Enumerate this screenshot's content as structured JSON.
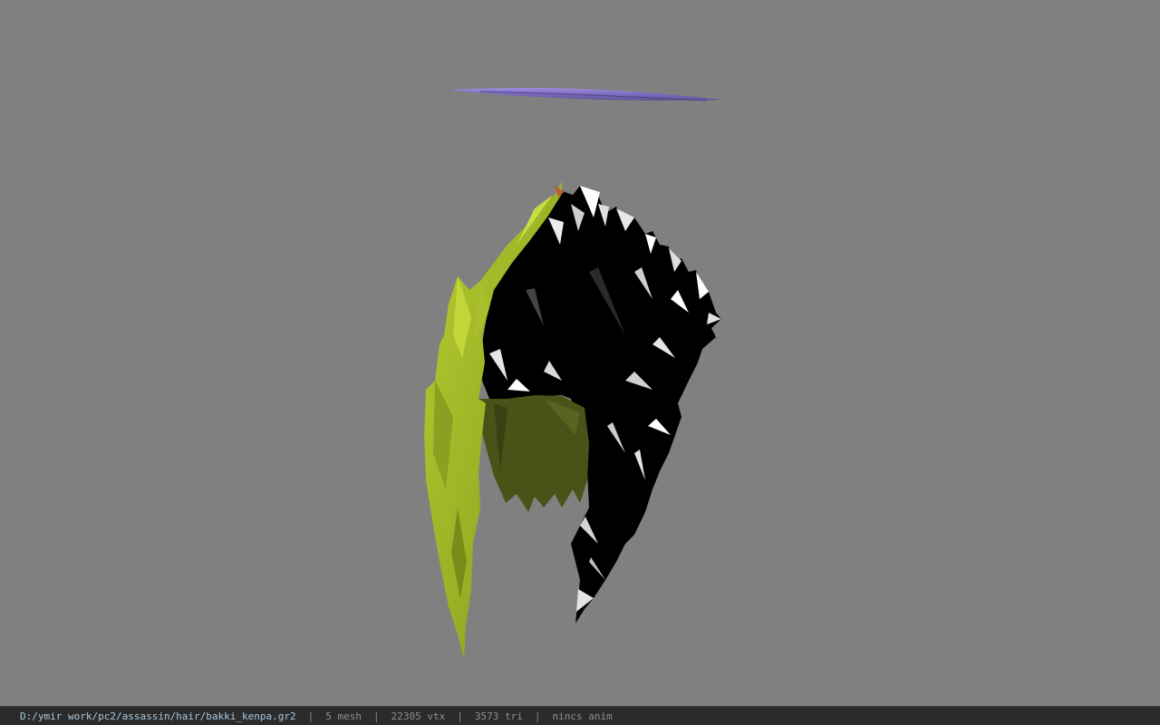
{
  "viewer": {
    "background_color": "#808080",
    "model": {
      "meshes": [
        {
          "name": "halo-ring",
          "color": "#8878c8"
        },
        {
          "name": "hair-front",
          "color": "#9aae28"
        },
        {
          "name": "hair-back",
          "color": "#000000"
        },
        {
          "name": "hair-inner",
          "color": "#4a5218"
        }
      ]
    }
  },
  "status_bar": {
    "file_path": "D:/ymir work/pc2/assassin/hair/bakki_kenpa.gr2",
    "separator": "|",
    "mesh_count": "5 mesh",
    "vertex_count": "22305 vtx",
    "triangle_count": "3573 tri",
    "anim_status": "nincs anim"
  }
}
